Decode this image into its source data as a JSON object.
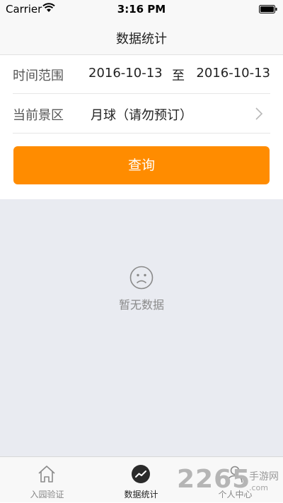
{
  "status_bar": {
    "carrier": "Carrier",
    "time": "3:16 PM"
  },
  "nav": {
    "title": "数据统计"
  },
  "form": {
    "time_range_label": "时间范围",
    "start_date": "2016-10-13",
    "separator": "至",
    "end_date": "2016-10-13",
    "scenic_label": "当前景区",
    "scenic_value": "月球（请勿预订）",
    "query_label": "查询"
  },
  "empty_state": {
    "icon": "sad-face-icon",
    "text": "暂无数据"
  },
  "tabs": [
    {
      "label": "入园验证",
      "icon": "home-icon"
    },
    {
      "label": "数据统计",
      "icon": "chart-icon"
    },
    {
      "label": "个人中心",
      "icon": "person-icon"
    }
  ],
  "watermark": {
    "number": "2265",
    "text": "手游网",
    "domain": ".com"
  },
  "colors": {
    "accent": "#ff8c00",
    "content_background": "#e9ebf1"
  }
}
